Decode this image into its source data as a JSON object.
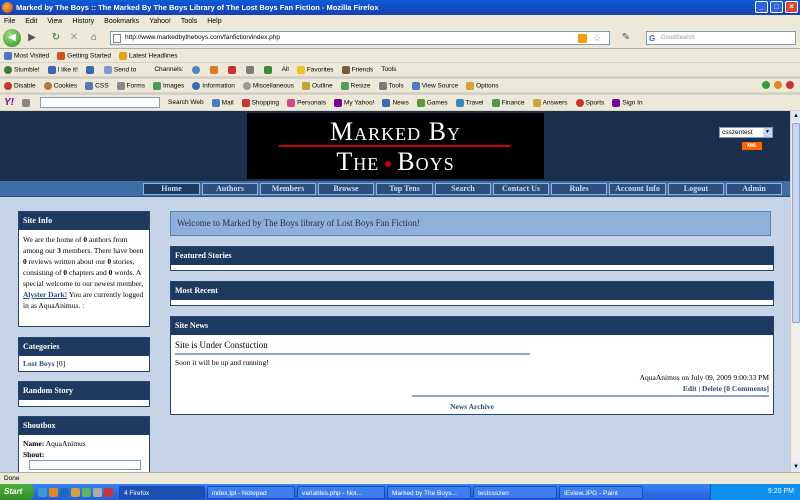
{
  "window": {
    "title": "Marked by The Boys :: The Marked By The Boys Library of The Lost Boys Fan Fiction - Mozilla Firefox"
  },
  "menu": [
    "File",
    "Edit",
    "View",
    "History",
    "Bookmarks",
    "Yahoo!",
    "Tools",
    "Help"
  ],
  "address": {
    "url": "http://www.markedbytheboys.com/fanfiction/index.php",
    "search_placeholder": "GoodSearch"
  },
  "bookmarks": [
    "Most Visited",
    "Getting Started",
    "Latest Headlines"
  ],
  "stumble_toolbar": [
    "Stumble!",
    "I like it!",
    "Send to",
    "Channels:",
    "All",
    "Favorites",
    "Friends",
    "Tools"
  ],
  "webdev_toolbar": [
    "Disable",
    "Cookies",
    "CSS",
    "Forms",
    "Images",
    "Information",
    "Miscellaneous",
    "Outline",
    "Resize",
    "Tools",
    "View Source",
    "Options"
  ],
  "yahoo_toolbar": [
    "Search Web",
    "Mail",
    "Shopping",
    "Personals",
    "My Yahoo!",
    "News",
    "Games",
    "Travel",
    "Finance",
    "Answers",
    "Sports",
    "Sign In"
  ],
  "site": {
    "banner_line1": "Marked By",
    "banner_line2_a": "The",
    "banner_line2_b": "Boys",
    "skin_select": "csszentest",
    "xml_badge": "XML",
    "nav": [
      "Home",
      "Authors",
      "Members",
      "Browse",
      "Top Tens",
      "Search",
      "Contact Us",
      "Rules",
      "Account Info",
      "Logout",
      "Admin"
    ],
    "welcome": "Welcome to Marked by The Boys library of Lost Boys Fan Fiction!",
    "site_info": {
      "title": "Site Info",
      "t1": "We are the home of ",
      "authors": "0",
      "t2": " authors from among our ",
      "members": "3",
      "t3": " members. There have been ",
      "reviews": "0",
      "t4": " reviews written about our ",
      "stories": "0",
      "t5": " stories, consisting of ",
      "chapters": "0",
      "t6": " chapters and ",
      "words": "0",
      "t7": " words. A special welcome to our newest member, ",
      "newest_member": "Alyster Dark!",
      "t8": " You are currently logged in as AquaAnimus. :"
    },
    "categories": {
      "title": "Categories",
      "item": "Lost Boys",
      "count": "[0]"
    },
    "random_story": {
      "title": "Random Story"
    },
    "shoutbox": {
      "title": "Shoutbox",
      "name_label": "Name:",
      "name_value": "AquaAnimus",
      "shout_label": "Shout:"
    },
    "featured": {
      "title": "Featured Stories"
    },
    "recent": {
      "title": "Most Recent"
    },
    "news": {
      "title": "Site News",
      "headline": "Site is Under Constuction",
      "body": "Soon it will be up and running!",
      "byline": "AquaAnimus on July 09, 2009 9:00:33 PM",
      "edit": "Edit",
      "delete": "Delete",
      "comments": "[0 Comments]",
      "archive": "News Archive"
    }
  },
  "status": "Done",
  "taskbar": {
    "start": "Start",
    "tasks": [
      "4 Firefox",
      "index.tpl - Notepad",
      "variables.php - Not...",
      "Marked by The Boys...",
      "testcsszen",
      "IEview.JPG - Paint"
    ],
    "clock": "9:20 PM"
  }
}
